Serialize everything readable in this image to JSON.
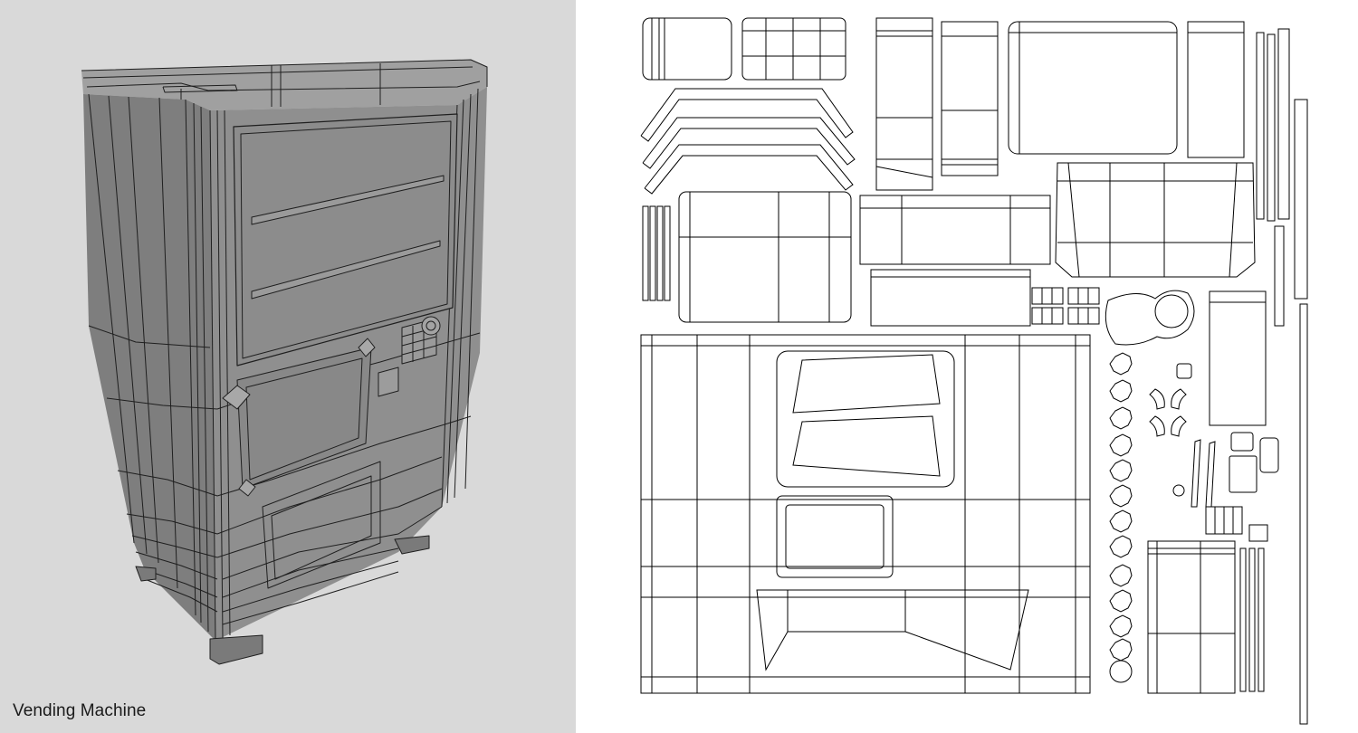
{
  "caption": "Vending Machine",
  "colors": {
    "viewport_background": "#d9d9d9",
    "model_body": "#8a8a8a",
    "model_front": "#8f8f8f",
    "model_side": "#7e7e7e",
    "model_top": "#a0a0a0",
    "wire": "#1f1f1f",
    "uv_background": "#ffffff",
    "uv_line": "#000000"
  }
}
